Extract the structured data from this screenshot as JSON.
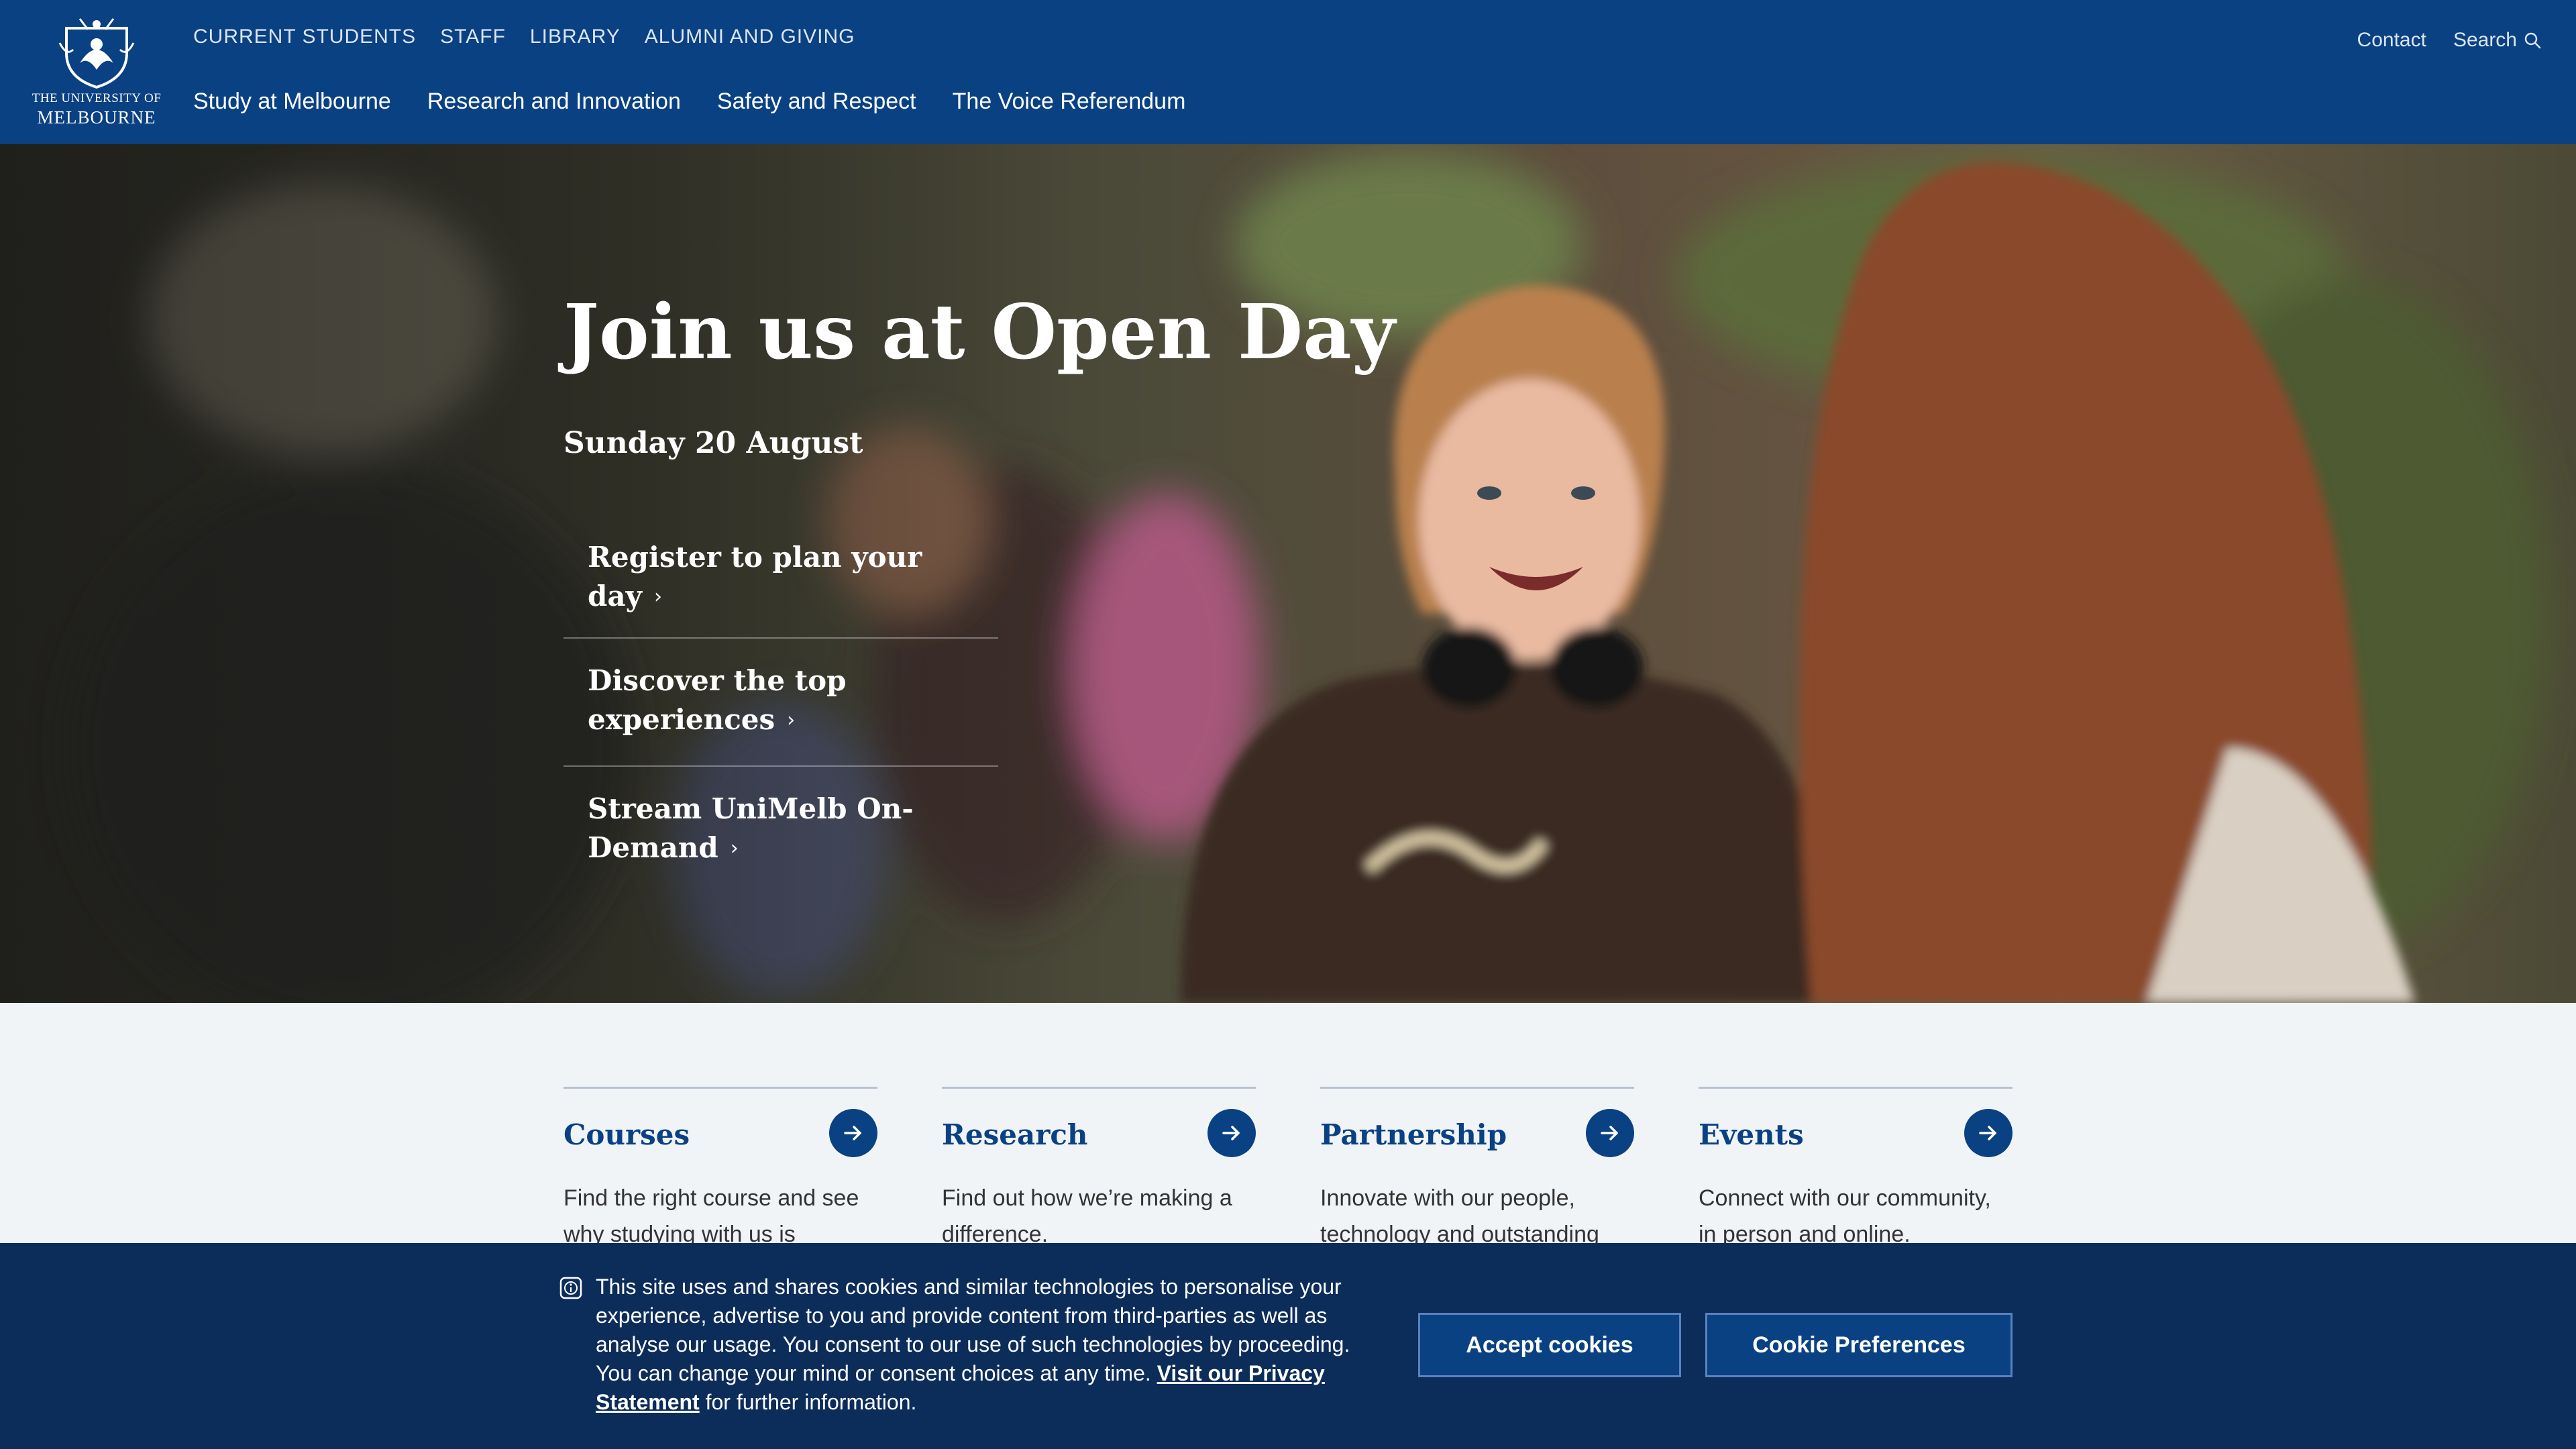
{
  "header": {
    "logo": {
      "line_small": "THE UNIVERSITY OF",
      "line_big": "MELBOURNE"
    },
    "utility_nav": [
      "CURRENT STUDENTS",
      "STAFF",
      "LIBRARY",
      "ALUMNI AND GIVING"
    ],
    "main_nav": [
      "Study at Melbourne",
      "Research and Innovation",
      "Safety and Respect",
      "The Voice Referendum"
    ],
    "contact_label": "Contact",
    "search_label": "Search",
    "background_color": "#094183"
  },
  "hero": {
    "title": "Join us at Open Day",
    "date": "Sunday 20 August",
    "links": [
      {
        "line1": "Register to plan your day",
        "line2": ""
      },
      {
        "line1": "Discover the top",
        "line2": "experiences"
      },
      {
        "line1": "Stream UniMelb On-",
        "line2": "Demand"
      }
    ]
  },
  "cards": [
    {
      "title": "Courses",
      "desc": "Find the right course and see why studying with us is"
    },
    {
      "title": "Research",
      "desc": "Find out how we’re making a difference."
    },
    {
      "title": "Partnership",
      "desc": "Innovate with our people, technology and outstanding"
    },
    {
      "title": "Events",
      "desc": "Connect with our community, in person and online."
    }
  ],
  "cookie_banner": {
    "text": "This site uses and shares cookies and similar technologies to personalise your experience, advertise to you and provide content from third-parties as well as analyse our usage. You consent to our use of such technologies by proceeding. You can change your mind or consent choices at any time.",
    "privacy_link": "Visit our Privacy Statement",
    "text_after": "for further information.",
    "accept_label": "Accept cookies",
    "preferences_label": "Cookie Preferences"
  }
}
